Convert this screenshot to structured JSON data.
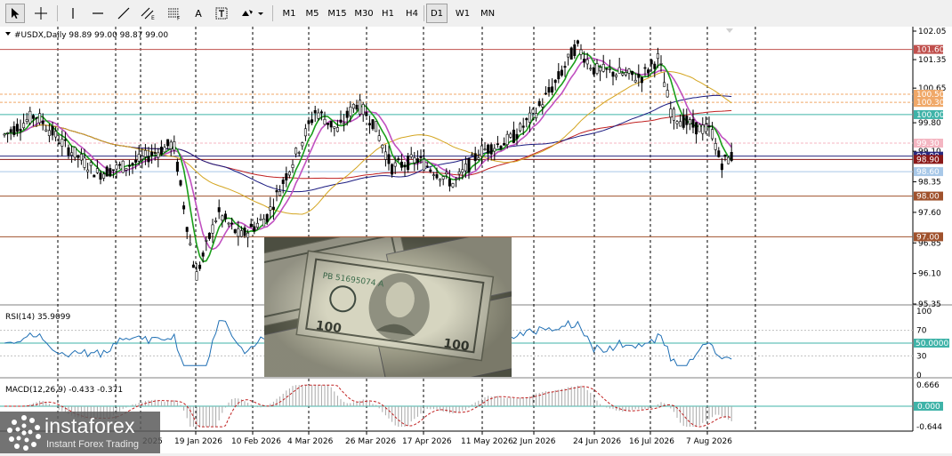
{
  "toolbar": {
    "text_tool": "A",
    "timeframes": [
      "M1",
      "M5",
      "M15",
      "M30",
      "H1",
      "H4",
      "D1",
      "W1",
      "MN"
    ]
  },
  "chart": {
    "symbol_line": "#USDX,Daily  98.89 99.00 98.87 99.00",
    "price_axis": {
      "ticks": [
        "102.05",
        "101.35",
        "100.65",
        "99.80",
        "99.10",
        "98.35",
        "97.60",
        "96.85",
        "96.10",
        "95.35"
      ],
      "levels": [
        {
          "label": "101.60",
          "color": "#c0504d"
        },
        {
          "label": "100.50",
          "color": "#f0a868"
        },
        {
          "label": "100.30",
          "color": "#f0a868"
        },
        {
          "label": "100.00",
          "color": "#3fb3a8"
        },
        {
          "label": "99.30",
          "color": "#f4b6c2"
        },
        {
          "label": "98.98",
          "color": "#2a2a80"
        },
        {
          "label": "98.90",
          "color": "#8a1818"
        },
        {
          "label": "98.60",
          "color": "#a8c8e8"
        },
        {
          "label": "98.00",
          "color": "#a0522d"
        },
        {
          "label": "97.00",
          "color": "#a0522d"
        }
      ]
    },
    "rsi": {
      "label": "RSI(14) 35.9099",
      "ticks": [
        "100",
        "70",
        "30",
        "0"
      ],
      "level_label": "50.0000"
    },
    "macd": {
      "label": "MACD(12,26,9) -0.433 -0.371",
      "ticks": [
        "0.666",
        "-0.644"
      ],
      "level_label": "0.000"
    },
    "dates": [
      "19 Jan 2026",
      "10 Feb 2026",
      "4 Mar 2026",
      "26 Mar 2026",
      "17 Apr 2026",
      "11 May 2026",
      "2 Jun 2026",
      "24 Jun 2026",
      "16 Jul 2026",
      "7 Aug 2026"
    ],
    "first_date_fragment": "2025",
    "colors": {
      "candle": "#000000",
      "ma_fast": "#1a9e1a",
      "ma_mid": "#c050c0",
      "ma_slow1": "#d4a520",
      "ma_slow2": "#1a1a80",
      "ma_slow3": "#c02020"
    }
  },
  "watermark": {
    "brand": "instaforex",
    "tagline": "Instant Forex Trading"
  }
}
